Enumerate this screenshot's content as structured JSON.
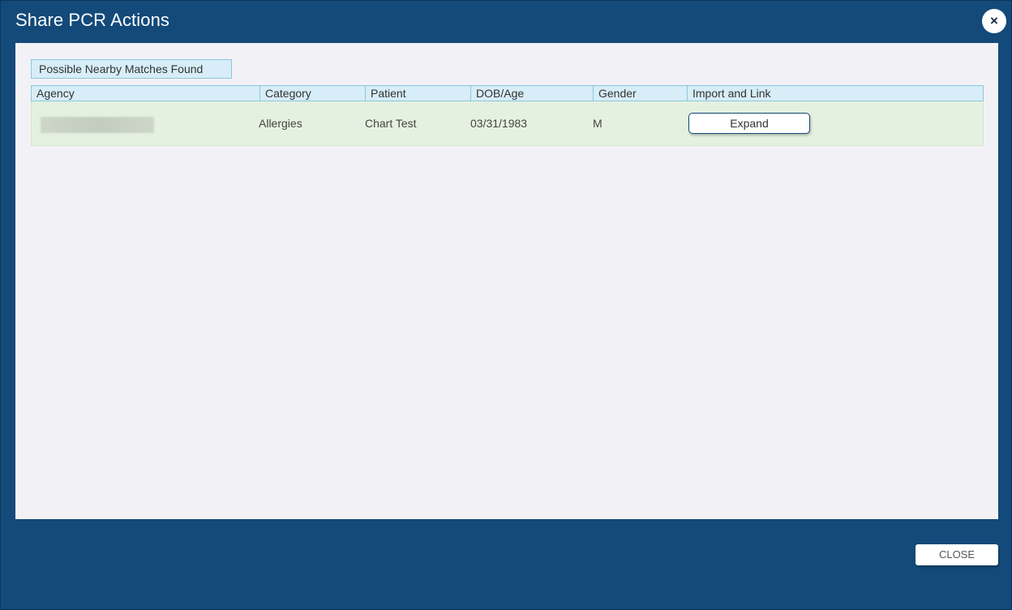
{
  "dialog": {
    "title": "Share PCR Actions",
    "close_icon": "×",
    "close_button_label": "CLOSE"
  },
  "section": {
    "label": "Possible Nearby Matches Found"
  },
  "table": {
    "columns": [
      "Agency",
      "Category",
      "Patient",
      "DOB/Age",
      "Gender",
      "Import and Link"
    ],
    "rows": [
      {
        "category": "Allergies",
        "patient": "Chart Test",
        "dob_age": "03/31/1983",
        "gender": "M",
        "action_label": "Expand"
      }
    ]
  },
  "colors": {
    "frame": "#134a7a",
    "panel": "#f2f2f6",
    "header_bg": "#d7edf7",
    "header_border": "#8cc7df",
    "row_bg": "#e5f1e0"
  }
}
